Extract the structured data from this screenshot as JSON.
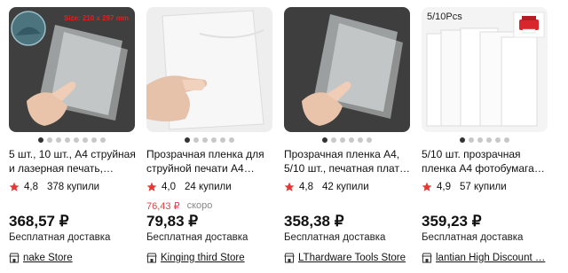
{
  "products": [
    {
      "image_badge": "Size: 210 x 297 mm",
      "title": "5 шт., 10 шт., А4 струйная и лазерная печать,…",
      "rating": "4,8",
      "purchases": "378 купили",
      "old_price": "",
      "old_price_note": "",
      "price": "368,57 ₽",
      "delivery": "Бесплатная доставка",
      "store": "nake Store"
    },
    {
      "image_badge": "",
      "title": "Прозрачная пленка для струйной печати A4…",
      "rating": "4,0",
      "purchases": "24 купили",
      "old_price": "76,43 ₽",
      "old_price_note": "скоро",
      "price": "79,83 ₽",
      "delivery": "Бесплатная доставка",
      "store": "Kinging third Store"
    },
    {
      "image_badge": "",
      "title": "Прозрачная пленка A4, 5/10 шт., печатная плат…",
      "rating": "4,8",
      "purchases": "42 купили",
      "old_price": "",
      "old_price_note": "",
      "price": "358,38 ₽",
      "delivery": "Бесплатная доставка",
      "store": "LThardware Tools Store"
    },
    {
      "image_badge": "5/10Pcs",
      "title": "5/10 шт. прозрачная пленка A4 фотобумага…",
      "rating": "4,9",
      "purchases": "57 купили",
      "old_price": "",
      "old_price_note": "",
      "price": "359,23 ₽",
      "delivery": "Бесплатная доставка",
      "store": "lantian High Discount …"
    }
  ],
  "colors": {
    "star": "#e53935",
    "old_price": "#e0434b",
    "thumb_dark": "#3e3e3e",
    "thumb_light": "#eeeeee",
    "badge_red": "#e02020"
  },
  "icons": {
    "rating": "star-icon",
    "store": "store-icon",
    "carousel": "carousel-dot"
  }
}
